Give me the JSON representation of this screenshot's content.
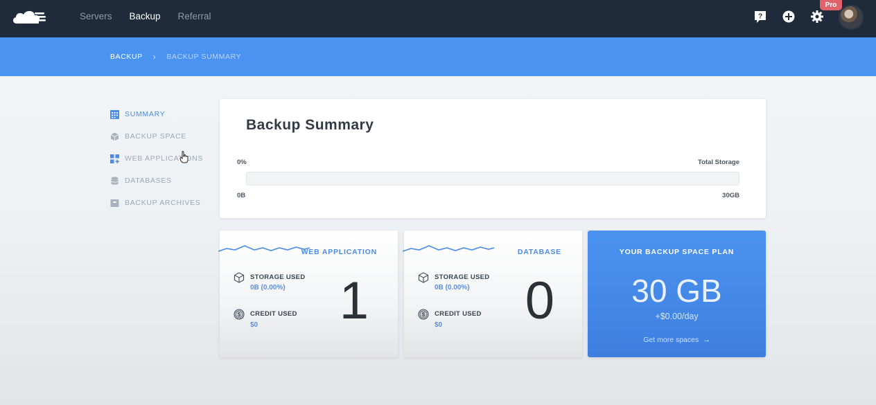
{
  "nav": {
    "links": [
      "Servers",
      "Backup",
      "Referral"
    ],
    "active": "Backup",
    "pro_badge": "Pro",
    "icons": [
      "help-icon",
      "add-icon",
      "gear-icon",
      "avatar"
    ]
  },
  "breadcrumb": {
    "root": "BACKUP",
    "separator": "›",
    "current": "BACKUP SUMMARY"
  },
  "sidebar": {
    "items": [
      {
        "label": "SUMMARY",
        "icon": "calendar-grid-icon",
        "active": true
      },
      {
        "label": "BACKUP SPACE",
        "icon": "cube-icon",
        "active": false
      },
      {
        "label": "WEB APPLICATIONS",
        "icon": "apps-icon",
        "active": false
      },
      {
        "label": "DATABASES",
        "icon": "database-icon",
        "active": false
      },
      {
        "label": "BACKUP ARCHIVES",
        "icon": "archive-icon",
        "active": false
      }
    ]
  },
  "summary": {
    "title": "Backup Summary",
    "percent": "0%",
    "total_label": "Total Storage",
    "used": "0B",
    "total": "30GB",
    "fill_fraction": 0
  },
  "web_app": {
    "title": "WEB APPLICATION",
    "storage_label": "STORAGE USED",
    "storage_value": "0B (0.00%)",
    "credit_label": "CREDIT USED",
    "credit_value": "$0",
    "count": "1"
  },
  "database": {
    "title": "DATABASE",
    "storage_label": "STORAGE USED",
    "storage_value": "0B (0.00%)",
    "credit_label": "CREDIT USED",
    "credit_value": "$0",
    "count": "0"
  },
  "plan": {
    "title": "YOUR BACKUP SPACE PLAN",
    "size": "30 GB",
    "price": "+$0.00/day",
    "link": "Get more spaces",
    "arrow": "→"
  },
  "colors": {
    "nav_bg": "#1f2a3a",
    "accent": "#4b93f1",
    "active_text": "#4b8ce8",
    "pro_badge": "#e2626a"
  }
}
